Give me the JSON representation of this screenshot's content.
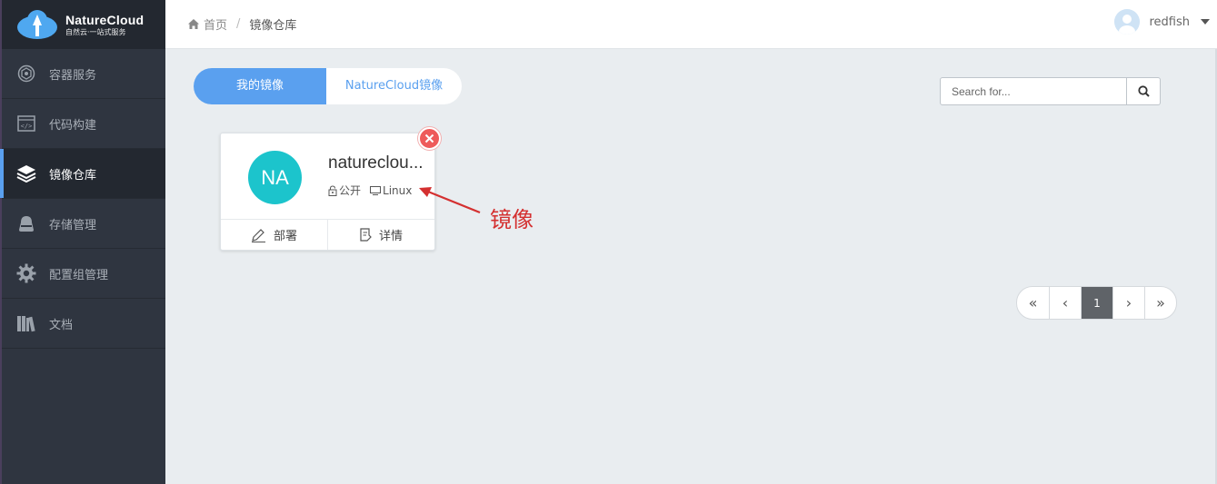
{
  "logo": {
    "title": "NatureCloud",
    "subtitle": "自然云·一站式服务"
  },
  "sidebar": {
    "items": [
      {
        "label": "容器服务",
        "icon": "cube-icon",
        "active": false
      },
      {
        "label": "代码构建",
        "icon": "code-icon",
        "active": false
      },
      {
        "label": "镜像仓库",
        "icon": "layers-icon",
        "active": true
      },
      {
        "label": "存储管理",
        "icon": "storage-icon",
        "active": false
      },
      {
        "label": "配置组管理",
        "icon": "gear-icon",
        "active": false
      },
      {
        "label": "文档",
        "icon": "books-icon",
        "active": false
      }
    ]
  },
  "header": {
    "breadcrumb": {
      "home": "首页",
      "separator": "/",
      "current": "镜像仓库"
    },
    "user": {
      "name": "redfish"
    }
  },
  "tabs": {
    "mine": "我的镜像",
    "official": "NatureCloud镜像"
  },
  "search": {
    "placeholder": "Search for..."
  },
  "card": {
    "initials": "NA",
    "name": "natureclou...",
    "visibility": "公开",
    "os": "Linux",
    "deploy_label": "部署",
    "details_label": "详情"
  },
  "annotation": {
    "label": "镜像"
  },
  "pagination": {
    "first": "«",
    "prev": "‹",
    "current": "1",
    "next": "›",
    "last": "»"
  },
  "colors": {
    "accent": "#5aa0ef",
    "sidebar_bg": "#2f3540",
    "avatar_bg": "#1cc4cc",
    "danger": "#ee5a5a",
    "annotation": "#d43030"
  }
}
